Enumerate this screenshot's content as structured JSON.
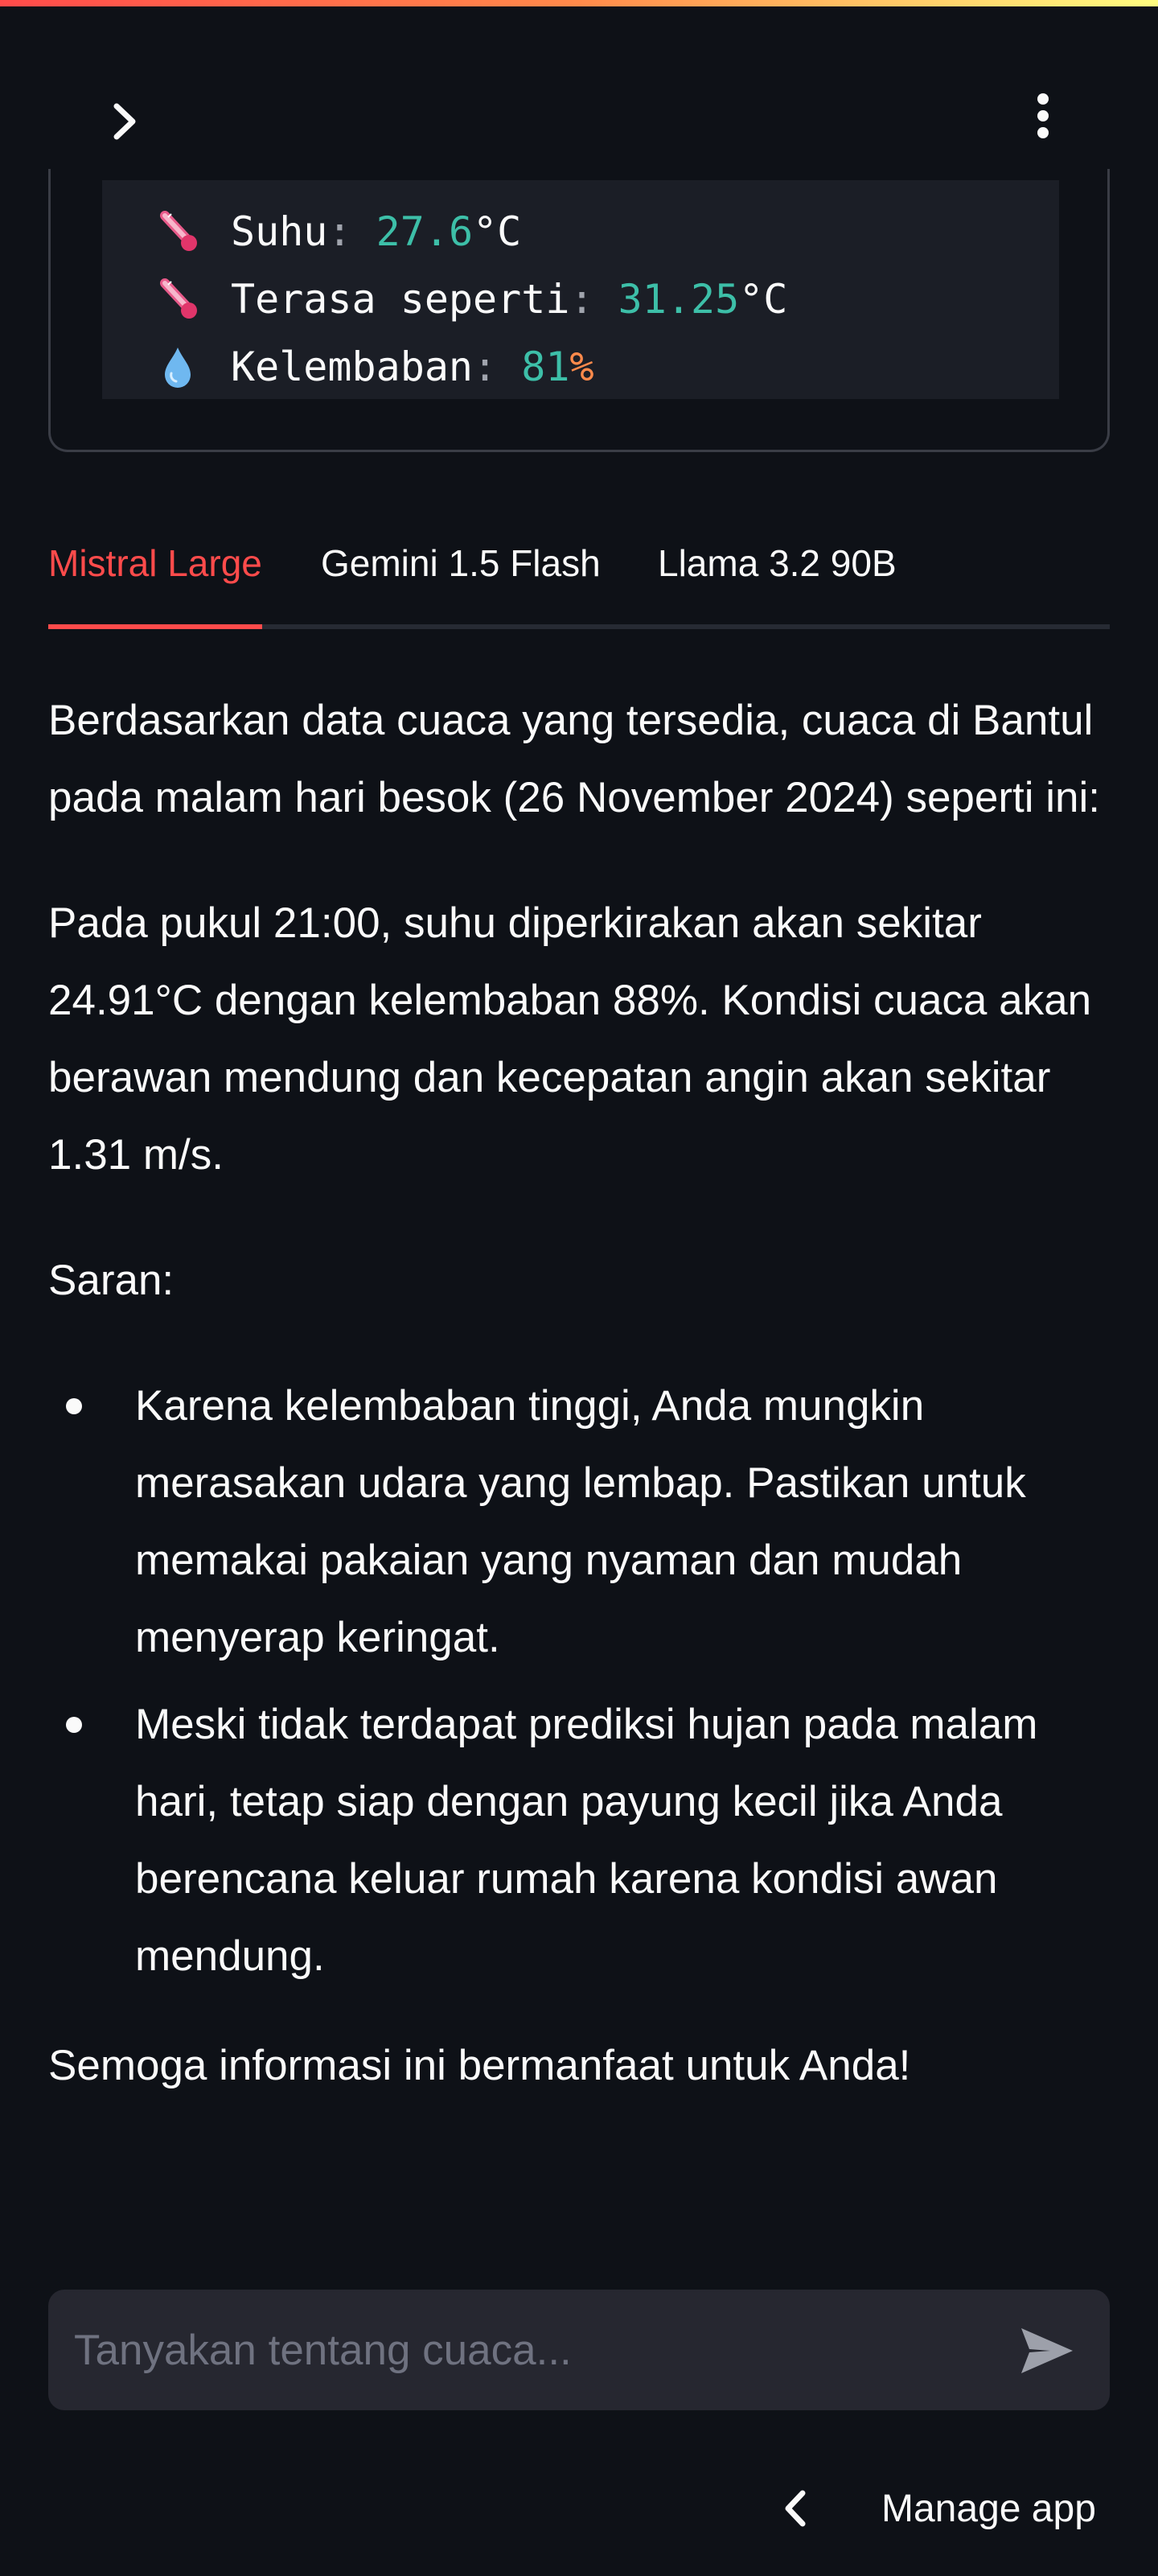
{
  "weather": {
    "lines": [
      {
        "icon": "thermometer-icon",
        "label": "Suhu",
        "value": "27.6",
        "unit": "°C"
      },
      {
        "icon": "thermometer-icon",
        "label": "Terasa seperti",
        "value": "31.25",
        "unit": "°C"
      },
      {
        "icon": "droplet-icon",
        "label": "Kelembaban",
        "value": "81",
        "unit": "%"
      }
    ]
  },
  "tabs": [
    {
      "label": "Mistral Large",
      "active": true
    },
    {
      "label": "Gemini 1.5 Flash",
      "active": false
    },
    {
      "label": "Llama 3.2 90B",
      "active": false
    }
  ],
  "response": {
    "intro": "Berdasarkan data cuaca yang tersedia, cuaca di Bantul pada malam hari besok (26 November 2024) seperti ini:",
    "forecast": "Pada pukul 21:00, suhu diperkirakan akan sekitar 24.91°C dengan kelembaban 88%. Kondisi cuaca akan berawan mendung dan kecepatan angin akan sekitar 1.31 m/s.",
    "advice_heading": "Saran:",
    "advice_items": [
      "Karena kelembaban tinggi, Anda mungkin merasakan udara yang lembap. Pastikan untuk memakai pakaian yang nyaman dan mudah menyerap keringat.",
      "Meski tidak terdapat prediksi hujan pada malam hari, tetap siap dengan payung kecil jika Anda berencana keluar rumah karena kondisi awan mendung."
    ],
    "closing": "Semoga informasi ini bermanfaat untuk Anda!"
  },
  "chat_input": {
    "placeholder": "Tanyakan tentang cuaca...",
    "value": ""
  },
  "footer": {
    "manage_app_label": "Manage app"
  },
  "colors": {
    "accent": "#ff4b4b",
    "background": "#0e1117",
    "code_number": "#3dbfa8",
    "code_percent": "#ff8a4b"
  }
}
